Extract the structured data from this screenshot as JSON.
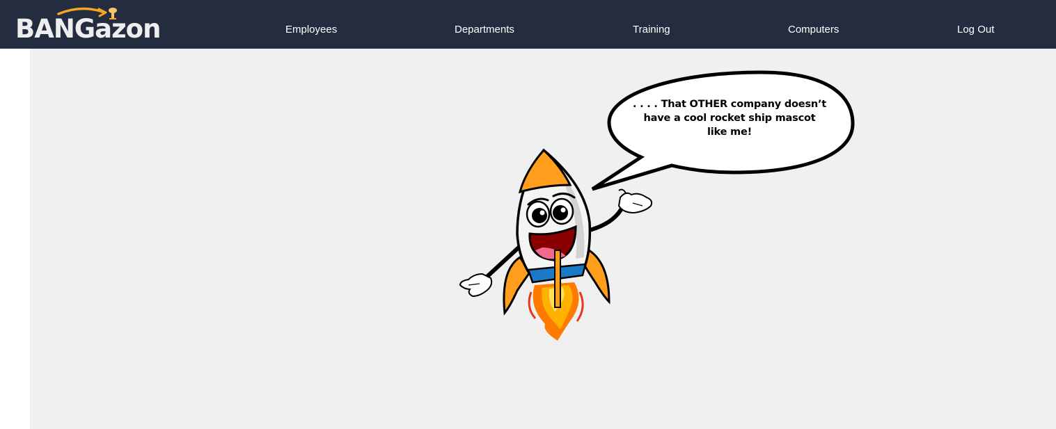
{
  "navbar": {
    "brand": "BANGazon",
    "links": [
      {
        "label": "Employees"
      },
      {
        "label": "Departments"
      },
      {
        "label": "Training"
      },
      {
        "label": "Computers"
      },
      {
        "label": "Log Out"
      }
    ]
  },
  "mascot": {
    "speech": ". . . . That OTHER company doesn’t have a cool rocket ship mascot like me!"
  },
  "colors": {
    "navbar_bg": "#232d3f",
    "content_bg": "#f0f0f0",
    "brand_accent": "#f5a623"
  }
}
